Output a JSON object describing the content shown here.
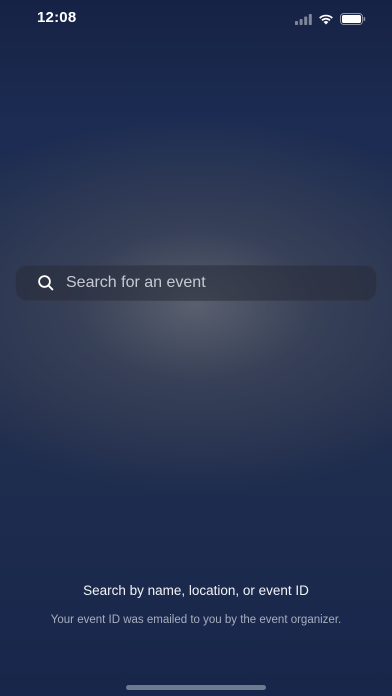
{
  "status_bar": {
    "time": "12:08",
    "icons": [
      "signal-icon",
      "wifi-icon",
      "battery-icon"
    ]
  },
  "search": {
    "placeholder": "Search for an event",
    "value": "",
    "icon": "search-icon"
  },
  "hint": {
    "title": "Search by name, location, or event ID",
    "subtitle": "Your event ID was emailed to you by the event organizer."
  },
  "colors": {
    "background_top": "#162245",
    "background_mid": "#232f4d",
    "glow": "#5c6270",
    "text_primary": "#ffffff",
    "text_secondary": "#a8aebf"
  }
}
